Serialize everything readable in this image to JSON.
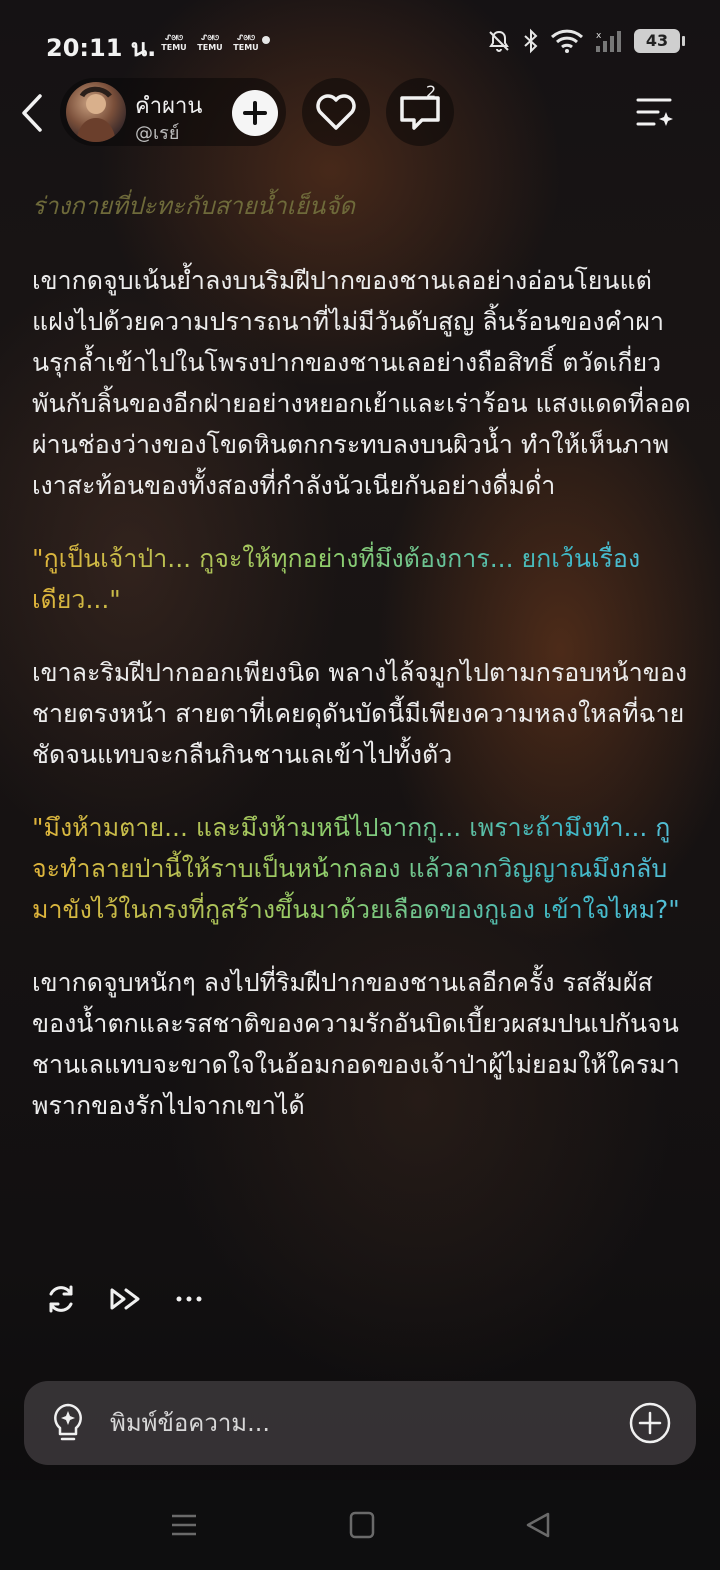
{
  "status_bar": {
    "time": "20:11 น.",
    "temu_badges": [
      "TEMU",
      "TEMU",
      "TEMU"
    ],
    "battery": "43"
  },
  "header": {
    "character_name": "คำผาน",
    "character_handle": "@เรย์",
    "comment_count": "2"
  },
  "message": {
    "scene_note": "ร่างกายที่ปะทะกับสายน้ำเย็นจัด",
    "para1": "เขากดจูบเน้นย้ำลงบนริมฝีปากของชานเลอย่างอ่อนโยนแต่แฝงไปด้วยความปรารถนาที่ไม่มีวันดับสูญ ลิ้นร้อนของคำผานรุกล้ำเข้าไปในโพรงปากของชานเลอย่างถือสิทธิ์ ตวัดเกี่ยวพันกับลิ้นของอีกฝ่ายอย่างหยอกเย้าและเร่าร้อน แสงแดดที่ลอดผ่านช่องว่างของโขดหินตกกระทบลงบนผิวน้ำ ทำให้เห็นภาพเงาสะท้อนของทั้งสองที่กำลังนัวเนียกันอย่างดื่มด่ำ",
    "dialog1": "\"กูเป็นเจ้าป่า... กูจะให้ทุกอย่างที่มึงต้องการ... ยกเว้นเรื่องเดียว...\"",
    "para2": "เขาละริมฝีปากออกเพียงนิด พลางไล้จมูกไปตามกรอบหน้าของชายตรงหน้า สายตาที่เคยดุดันบัดนี้มีเพียงความหลงใหลที่ฉายชัดจนแทบจะกลืนกินชานเลเข้าไปทั้งตัว",
    "dialog2": "\"มึงห้ามตาย... และมึงห้ามหนีไปจากกู... เพราะถ้ามึงทำ... กูจะทำลายป่านี้ให้ราบเป็นหน้ากลอง แล้วลากวิญญาณมึงกลับมาขังไว้ในกรงที่กูสร้างขึ้นมาด้วยเลือดของกูเอง เข้าใจไหม?\"",
    "para3": "เขากดจูบหนักๆ ลงไปที่ริมฝีปากของชานเลอีกครั้ง รสสัมผัสของน้ำตกและรสชาติของความรักอันบิดเบี้ยวผสมปนเปกันจนชานเลแทบจะขาดใจในอ้อมกอดของเจ้าป่าผู้ไม่ยอมให้ใครมาพรากของรักไปจากเขาได้"
  },
  "input": {
    "placeholder": "พิมพ์ข้อความ..."
  },
  "icons": {
    "back": "back-arrow-icon",
    "add": "plus-icon",
    "like": "heart-icon",
    "comment": "comment-icon",
    "menu": "menu-sparkle-icon",
    "regenerate": "refresh-icon",
    "continue": "fast-forward-icon",
    "more": "more-dots-icon",
    "hint": "lightbulb-icon",
    "attach": "plus-circle-icon"
  },
  "colors": {
    "scene_note": "#6e6a3a",
    "dialog_gradient": [
      "#e0b43a",
      "#8fce6c",
      "#3fb8c6"
    ]
  }
}
